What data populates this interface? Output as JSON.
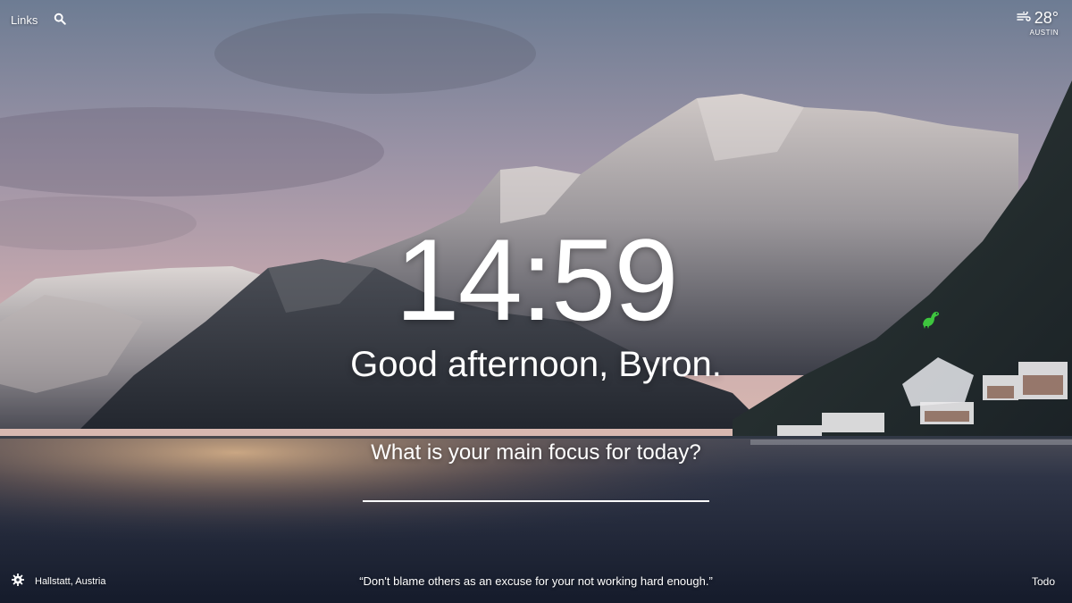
{
  "header": {
    "links_label": "Links",
    "search_icon": "search-icon"
  },
  "weather": {
    "icon": "wind-icon",
    "temperature": "28°",
    "location": "AUSTIN"
  },
  "main": {
    "time": "14:59",
    "greeting": "Good afternoon, Byron.",
    "focus_question": "What is your main focus for today?",
    "focus_value": ""
  },
  "footer": {
    "settings_icon": "gear-icon",
    "photo_location": "Hallstatt, Austria",
    "quote": "“Don't blame others as an excuse for your not working hard enough.”",
    "todo_label": "Todo"
  },
  "colors": {
    "sky_top": "#6f7d92",
    "sky_pink": "#c8a9ae",
    "lake_dark": "#1c2436",
    "lake_glow": "#c49a72",
    "dino_green": "#3ec63e"
  }
}
